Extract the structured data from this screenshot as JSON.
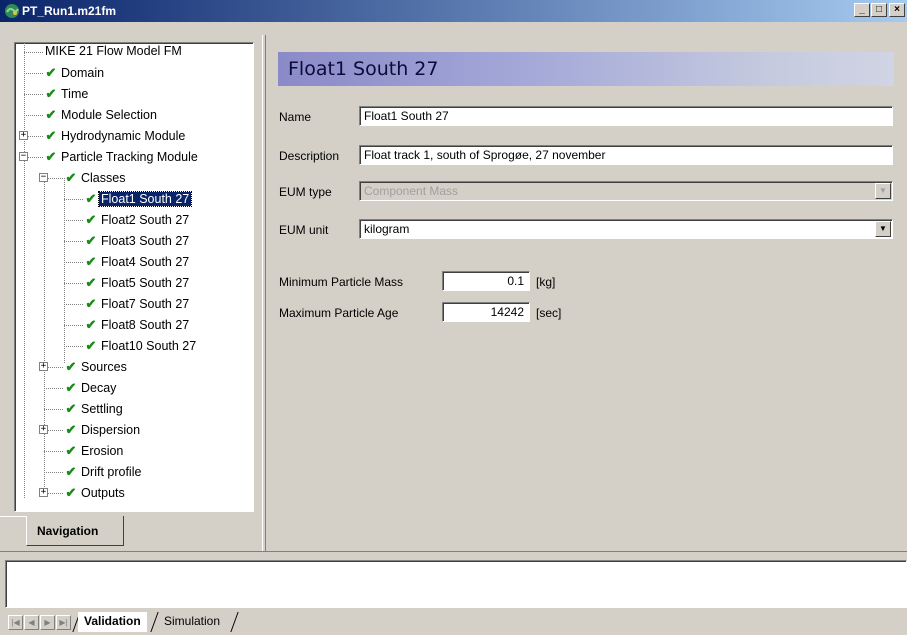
{
  "window": {
    "title": "PT_Run1.m21fm"
  },
  "titlebar_buttons": {
    "minimize": "_",
    "maximize": "□",
    "close": "×"
  },
  "tree": {
    "items": [
      {
        "label": "MIKE 21 Flow Model FM",
        "check": false
      },
      {
        "label": "Domain",
        "check": true
      },
      {
        "label": "Time",
        "check": true
      },
      {
        "label": "Module Selection",
        "check": true
      },
      {
        "label": "Hydrodynamic Module",
        "check": true,
        "expander": "+"
      },
      {
        "label": "Particle Tracking Module",
        "check": true,
        "expander": "−"
      },
      {
        "label": "Classes",
        "check": true,
        "expander": "−"
      },
      {
        "label": "Float1 South 27",
        "check": true,
        "selected": true
      },
      {
        "label": "Float2 South 27",
        "check": true
      },
      {
        "label": "Float3 South 27",
        "check": true
      },
      {
        "label": "Float4 South 27",
        "check": true
      },
      {
        "label": "Float5 South 27",
        "check": true
      },
      {
        "label": "Float7 South 27",
        "check": true
      },
      {
        "label": "Float8 South 27",
        "check": true
      },
      {
        "label": "Float10 South 27",
        "check": true
      },
      {
        "label": "Sources",
        "check": true,
        "expander": "+"
      },
      {
        "label": "Decay",
        "check": true
      },
      {
        "label": "Settling",
        "check": true
      },
      {
        "label": "Dispersion",
        "check": true,
        "expander": "+"
      },
      {
        "label": "Erosion",
        "check": true
      },
      {
        "label": "Drift profile",
        "check": true
      },
      {
        "label": "Outputs",
        "check": true,
        "expander": "+"
      }
    ],
    "check_glyph": "✔"
  },
  "navigation_tab": "Navigation",
  "panel": {
    "header": "Float1 South 27",
    "name_label": "Name",
    "name_value": "Float1 South 27",
    "description_label": "Description",
    "description_value": "Float track 1, south of Sprogøe, 27 november",
    "eum_type_label": "EUM type",
    "eum_type_value": "Component Mass",
    "eum_unit_label": "EUM unit",
    "eum_unit_value": "kilogram",
    "min_mass_label": "Minimum Particle Mass",
    "min_mass_value": "0.1",
    "min_mass_unit": "[kg]",
    "max_age_label": "Maximum Particle Age",
    "max_age_value": "14242",
    "max_age_unit": "[sec]",
    "dropdown_glyph": "▼"
  },
  "bottom": {
    "nav_arrows": [
      "|◀",
      "◀",
      "▶",
      "▶|"
    ],
    "tabs": [
      "Validation",
      "Simulation"
    ]
  }
}
